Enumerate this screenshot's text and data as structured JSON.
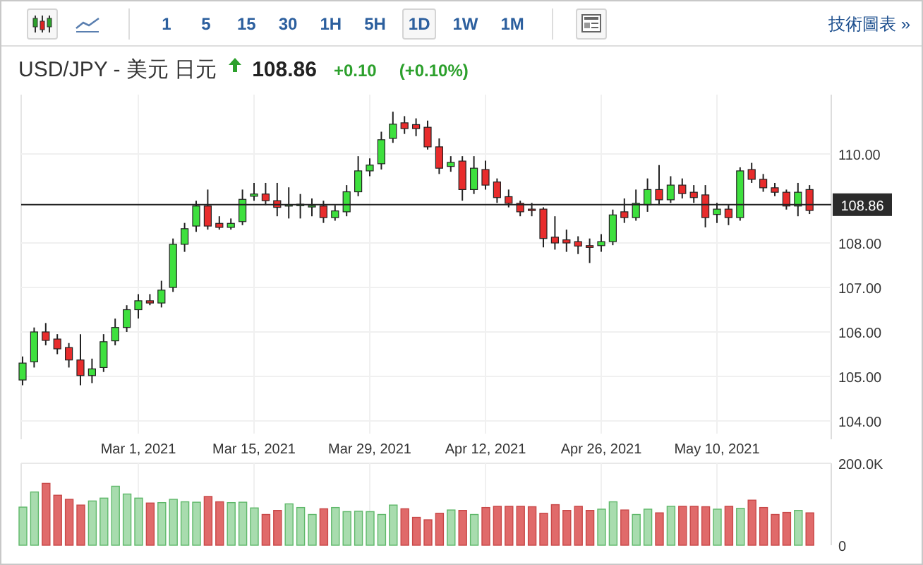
{
  "toolbar": {
    "chart_types": [
      {
        "kind": "candlestick",
        "selected": true
      },
      {
        "kind": "line",
        "selected": false
      }
    ],
    "intervals": [
      {
        "label": "1",
        "selected": false
      },
      {
        "label": "5",
        "selected": false
      },
      {
        "label": "15",
        "selected": false
      },
      {
        "label": "30",
        "selected": false
      },
      {
        "label": "1H",
        "selected": false
      },
      {
        "label": "5H",
        "selected": false
      },
      {
        "label": "1D",
        "selected": true
      },
      {
        "label": "1W",
        "selected": false
      },
      {
        "label": "1M",
        "selected": false
      }
    ],
    "link": "技術圖表 »"
  },
  "quote": {
    "symbol": "USD/JPY - 美元 日元",
    "rising": true,
    "price": "108.86",
    "change": "+0.10",
    "change_percent": "(+0.10%)"
  },
  "price_chart": {
    "price_labels": [
      "110.00",
      "108.00",
      "107.00",
      "106.00",
      "105.00",
      "104.00"
    ],
    "date_labels": [
      "Mar 1, 2021",
      "Mar 15, 2021",
      "Mar 29, 2021",
      "Apr 12, 2021",
      "Apr 26, 2021",
      "May 10, 2021"
    ],
    "current_price": "108.86"
  },
  "volume_chart": {
    "chart_data": {
      "type": "bar",
      "stacked": true,
      "grid": true,
      "ylim": [
        0,
        200
      ],
      "yticks": [
        {
          "value": 0,
          "label": "0"
        },
        {
          "value": 200,
          "label": "200.0K"
        }
      ],
      "series": [
        {
          "color": "#a8dcae",
          "values": [
            93,
            130,
            null,
            null,
            null,
            null,
            108,
            115,
            144,
            125,
            115,
            null,
            104,
            112,
            106,
            105,
            null,
            null,
            104,
            105,
            91,
            null,
            null,
            101,
            92,
            75,
            null,
            92,
            82,
            83,
            82,
            75,
            98,
            null,
            null,
            null,
            null,
            86,
            null,
            75,
            null,
            null,
            null,
            null,
            null,
            null,
            null,
            null,
            null,
            null,
            88,
            106,
            null,
            75,
            88,
            null,
            95,
            null,
            null,
            null,
            88,
            null,
            90,
            null,
            null,
            null,
            null,
            85,
            null
          ]
        },
        {
          "color": "#e06a6a",
          "values": [
            null,
            null,
            151,
            122,
            112,
            98,
            null,
            null,
            null,
            null,
            null,
            103,
            null,
            null,
            null,
            null,
            119,
            106,
            null,
            null,
            null,
            75,
            85,
            null,
            null,
            null,
            89,
            null,
            null,
            null,
            null,
            null,
            null,
            89,
            68,
            62,
            78,
            null,
            85,
            null,
            92,
            95,
            95,
            95,
            94,
            78,
            99,
            85,
            95,
            85,
            null,
            null,
            86,
            null,
            null,
            79,
            null,
            95,
            95,
            94,
            null,
            95,
            null,
            110,
            92,
            75,
            80,
            null,
            79
          ]
        }
      ]
    }
  }
}
